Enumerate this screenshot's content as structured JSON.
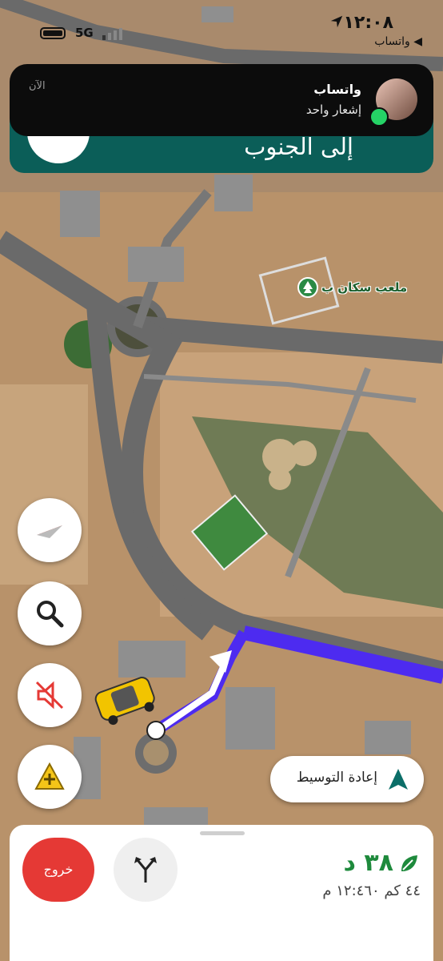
{
  "status_bar": {
    "time": "١٢:٠٨",
    "back_app": "◀ واتساب",
    "network": "5G"
  },
  "nav_banner": {
    "direction": "إلى الجنوب"
  },
  "notification": {
    "app": "واتساب",
    "message": "إشعار واحد",
    "time": "الآن"
  },
  "map": {
    "poi_label": "ملعب سكان ب",
    "route_color": "#4d2bf0"
  },
  "controls": {
    "recenter_label": "إعادة التوسيط"
  },
  "trip": {
    "exit_label": "خروج",
    "eta_duration": "٣٨ د",
    "distance_arrival": "٤٤ كم ١٢:٤٦٠ م"
  },
  "colors": {
    "banner": "#0b5e58",
    "exit": "#e53935",
    "eta": "#1e8a3c"
  }
}
